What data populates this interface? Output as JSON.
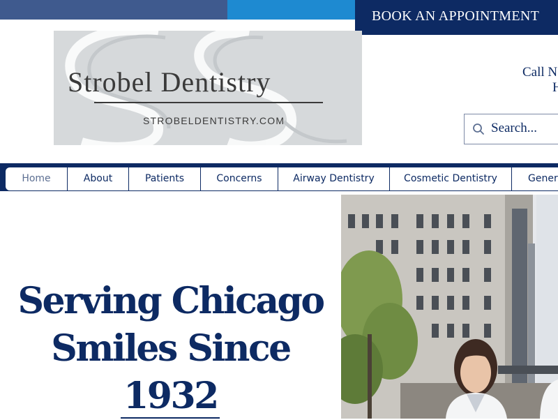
{
  "header": {
    "book_button": "BOOK AN APPOINTMENT",
    "call_line1": "Call N",
    "call_line2": "H"
  },
  "logo": {
    "title": "Strobel Dentistry",
    "url": "STROBELDENTISTRY.COM"
  },
  "search": {
    "placeholder": "Search..."
  },
  "nav": {
    "items": [
      "Home",
      "About",
      "Patients",
      "Concerns",
      "Airway Dentistry",
      "Cosmetic Dentistry",
      "Genera"
    ]
  },
  "hero": {
    "title_line1": "Serving Chicago",
    "title_line2": "Smiles Since 1932"
  },
  "colors": {
    "navy": "#0d2a63",
    "blue": "#1e8ad1",
    "slate": "#3f5a8e",
    "logo_bg": "#d6d9db"
  },
  "icons": [
    "search-icon"
  ]
}
